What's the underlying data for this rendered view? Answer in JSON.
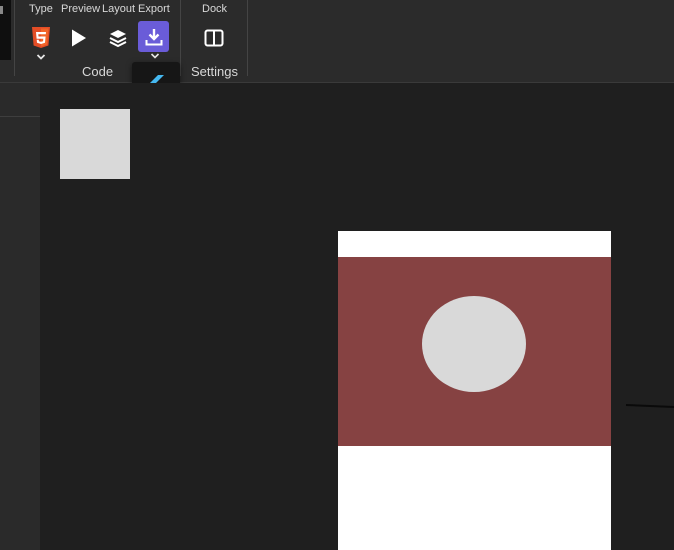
{
  "toolbar": {
    "type_label": "Type",
    "preview_label": "Preview",
    "layout_label": "Layout",
    "export_label": "Export",
    "dock_label": "Dock",
    "code_group_label": "Code",
    "settings_group_label": "Settings"
  },
  "icons": {
    "type": "html5-icon",
    "preview": "play-icon",
    "layout": "layers-icon",
    "export": "download-icon",
    "dock": "split-panel-icon"
  },
  "export_menu": {
    "items": [
      "flutter-icon",
      "html5-icon"
    ]
  },
  "colors": {
    "accent": "#6a5cd8",
    "html5": "#e44d26",
    "flutter": "#45b8f0",
    "band": "#864242",
    "shape": "#d9d9d9",
    "artboard": "#ffffff"
  }
}
